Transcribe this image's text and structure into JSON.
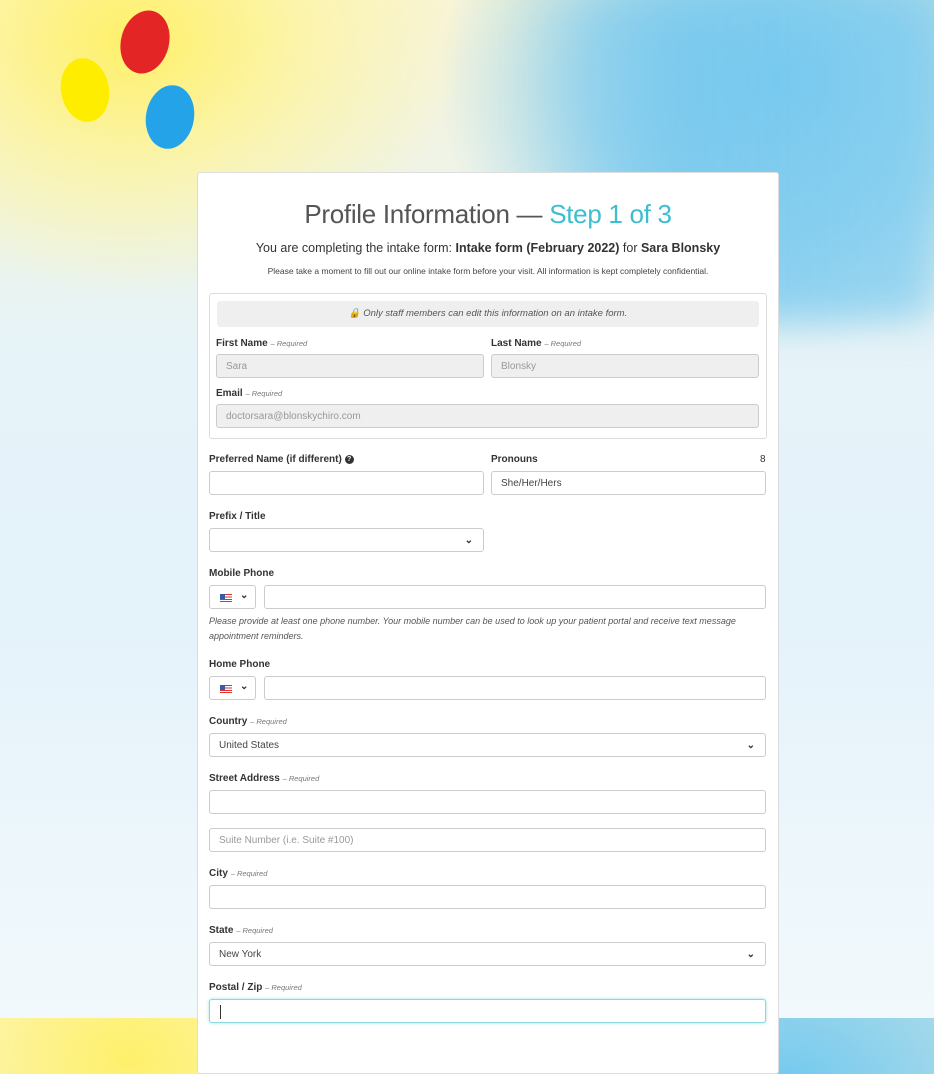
{
  "brand": {
    "logo": "three-petal-logo",
    "colors": {
      "red": "#e32526",
      "yellow": "#ffed00",
      "blue": "#25a3e9",
      "accent": "#3bbfcf"
    }
  },
  "header": {
    "title": "Profile Information — ",
    "step": "Step 1 of 3",
    "subtitle_prefix": "You are completing the intake form: ",
    "form_name": "Intake form (February 2022)",
    "subtitle_for": " for ",
    "patient_name": "Sara Blonsky",
    "note": "Please take a moment to fill out our online intake form before your visit. All information is kept completely confidential."
  },
  "locked_section": {
    "banner": "Only staff members can edit this information on an intake form.",
    "first_name": {
      "label": "First Name",
      "required": "– Required",
      "value": "Sara"
    },
    "last_name": {
      "label": "Last Name",
      "required": "– Required",
      "value": "Blonsky"
    },
    "email": {
      "label": "Email",
      "required": "– Required",
      "value": "doctorsara@blonskychiro.com"
    }
  },
  "fields": {
    "preferred_name": {
      "label": "Preferred Name (if different)",
      "value": ""
    },
    "pronouns": {
      "label": "Pronouns",
      "value": "She/Her/Hers",
      "counter": "8"
    },
    "prefix": {
      "label": "Prefix / Title",
      "value": ""
    },
    "mobile_phone": {
      "label": "Mobile Phone",
      "country": "US",
      "value": "",
      "help": "Please provide at least one phone number. Your mobile number can be used to look up your patient portal and receive text message appointment reminders."
    },
    "home_phone": {
      "label": "Home Phone",
      "country": "US",
      "value": ""
    },
    "country": {
      "label": "Country",
      "required": "– Required",
      "value": "United States"
    },
    "street": {
      "label": "Street Address",
      "required": "– Required",
      "value": "",
      "suite_placeholder": "Suite Number (i.e. Suite #100)"
    },
    "city": {
      "label": "City",
      "required": "– Required",
      "value": ""
    },
    "state": {
      "label": "State",
      "required": "– Required",
      "value": "New York"
    },
    "postal": {
      "label": "Postal / Zip",
      "required": "– Required",
      "value": ""
    }
  }
}
